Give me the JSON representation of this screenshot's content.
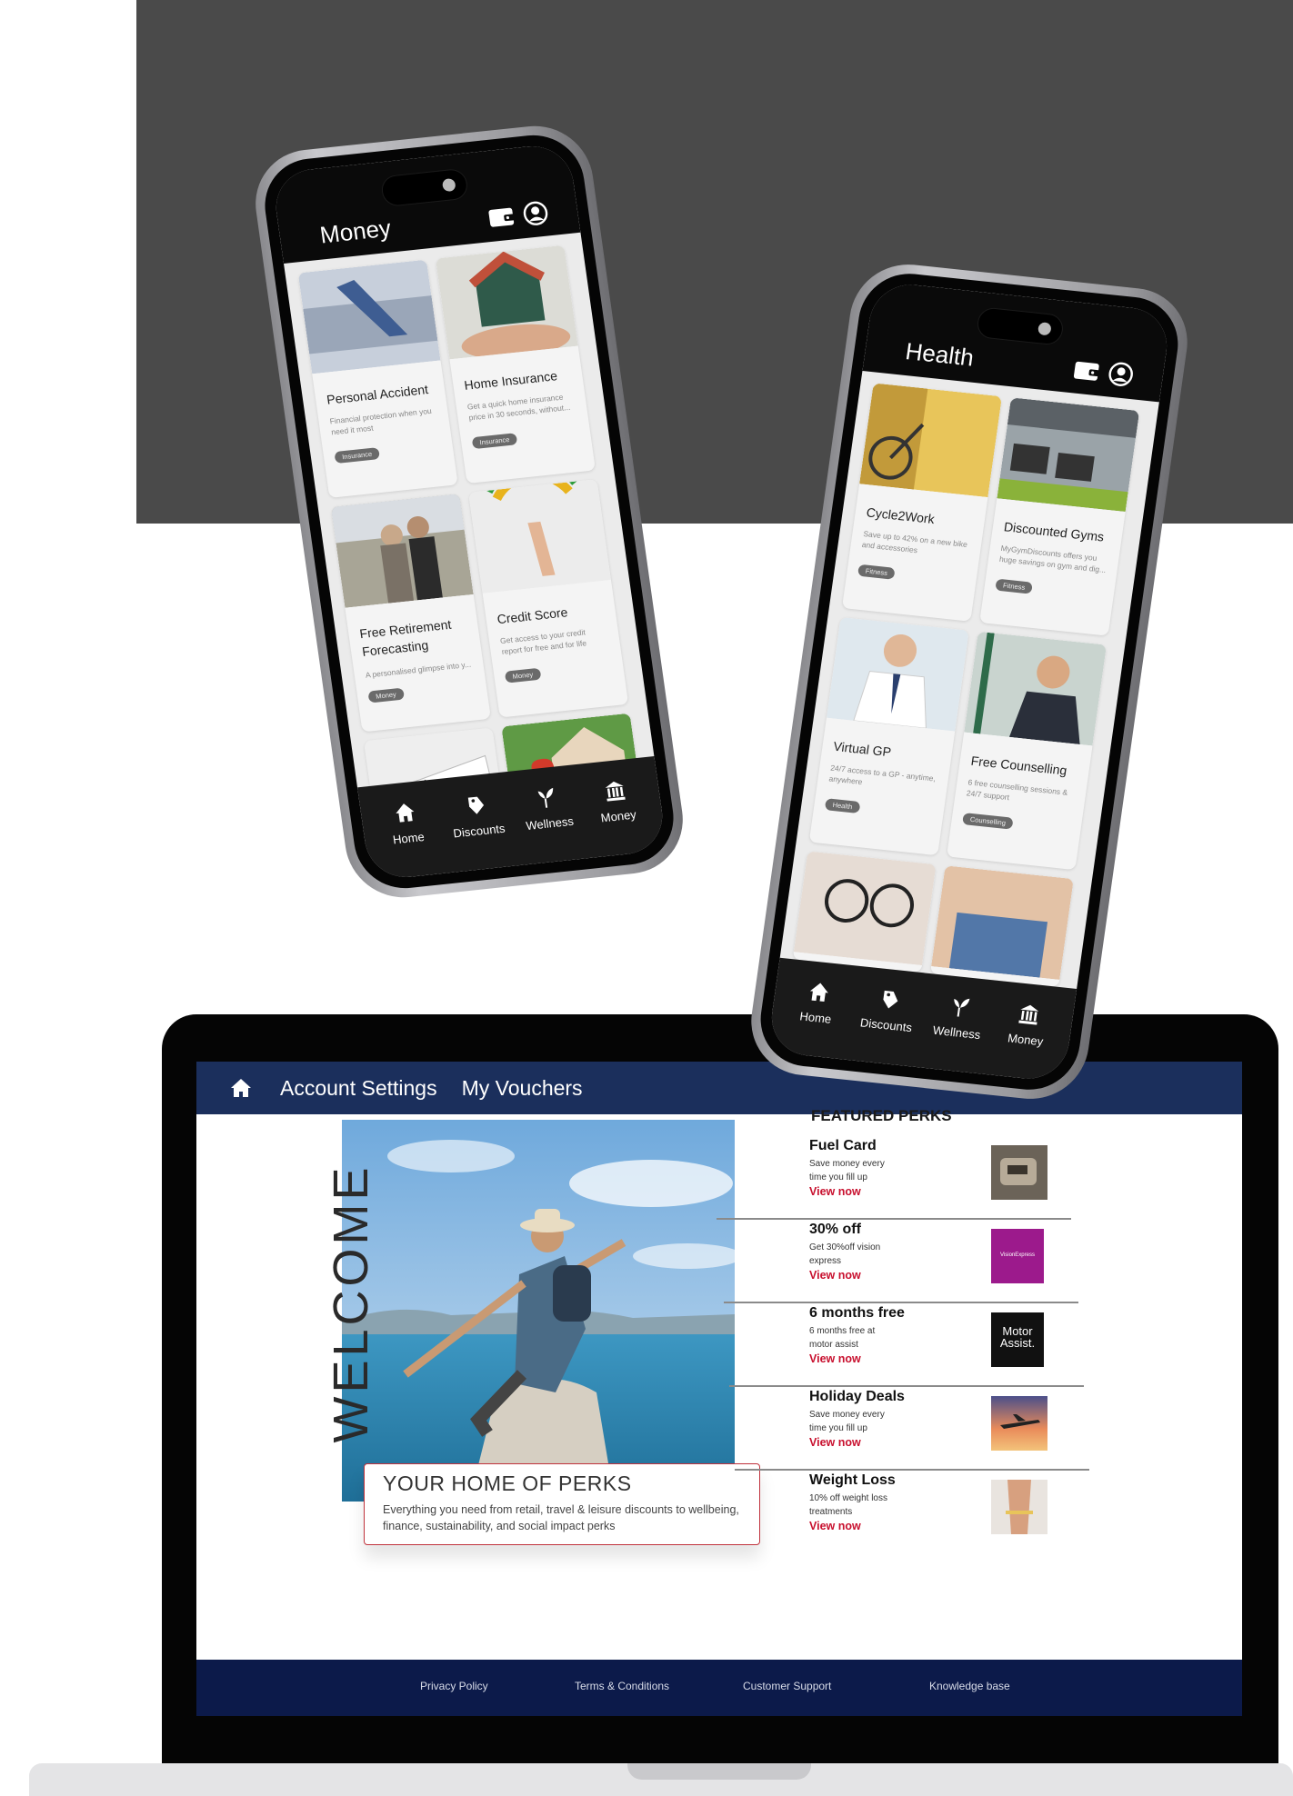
{
  "laptop": {
    "nav": {
      "account_settings": "Account Settings",
      "my_vouchers": "My Vouchers"
    },
    "welcome": "WELCOME",
    "caption": {
      "title": "YOUR HOME OF PERKS",
      "subtitle": "Everything you need from retail, travel & leisure discounts to wellbeing, finance, sustainability, and social impact perks"
    },
    "featured": {
      "heading": "FEATURED PERKS",
      "items": [
        {
          "title": "Fuel Card",
          "desc": "Save money every time you  fill up",
          "cta": "View now"
        },
        {
          "title": "30% off",
          "desc": "Get 30%off vision express",
          "cta": "View now",
          "thumb_text": "VisionExpress"
        },
        {
          "title": "6 months free",
          "desc": "6 months free at motor assist",
          "cta": "View now",
          "thumb_text_1": "Motor",
          "thumb_text_2": "Assist."
        },
        {
          "title": "Holiday Deals",
          "desc": "Save money every time you  fill up",
          "cta": "View now"
        },
        {
          "title": "Weight Loss",
          "desc": "10% off weight loss treatments",
          "cta": "View now"
        }
      ]
    },
    "footer": [
      "Privacy Policy",
      "Terms & Conditions",
      "Customer Support",
      "Knowledge base"
    ]
  },
  "phone_money": {
    "title": "Money",
    "cards": [
      {
        "title": "Personal Accident",
        "desc": "Financial protection when you need it most",
        "tag": "Insurance"
      },
      {
        "title": "Home Insurance",
        "desc": "Get a quick home insurance price in 30 seconds, without...",
        "tag": "Insurance"
      },
      {
        "title": "Free Retirement Forecasting",
        "desc": "A personalised glimpse into y...",
        "tag": "Money"
      },
      {
        "title": "Credit Score",
        "desc": "Get access to your credit report for free and for life",
        "tag": "Money"
      }
    ],
    "tabs": [
      "Home",
      "Discounts",
      "Wellness",
      "Money"
    ]
  },
  "phone_health": {
    "title": "Health",
    "cards": [
      {
        "title": "Cycle2Work",
        "desc": "Save up to 42% on a new bike and accessories",
        "tag": "Fitness"
      },
      {
        "title": "Discounted Gyms",
        "desc": "MyGymDiscounts offers you huge savings on gym and dig...",
        "tag": "Fitness"
      },
      {
        "title": "Virtual GP",
        "desc": "24/7 access to a GP - anytime, anywhere",
        "tag": "Health"
      },
      {
        "title": "Free Counselling",
        "desc": "6 free counselling sessions & 24/7 support",
        "tag": "Counselling"
      }
    ],
    "tabs": [
      "Home",
      "Discounts",
      "Wellness",
      "Money"
    ]
  },
  "colors": {
    "nav_bg": "#1b2f5c",
    "footer_bg": "#0c1a4a",
    "cta_red": "#c8102e",
    "backdrop": "#4a4a4a"
  }
}
